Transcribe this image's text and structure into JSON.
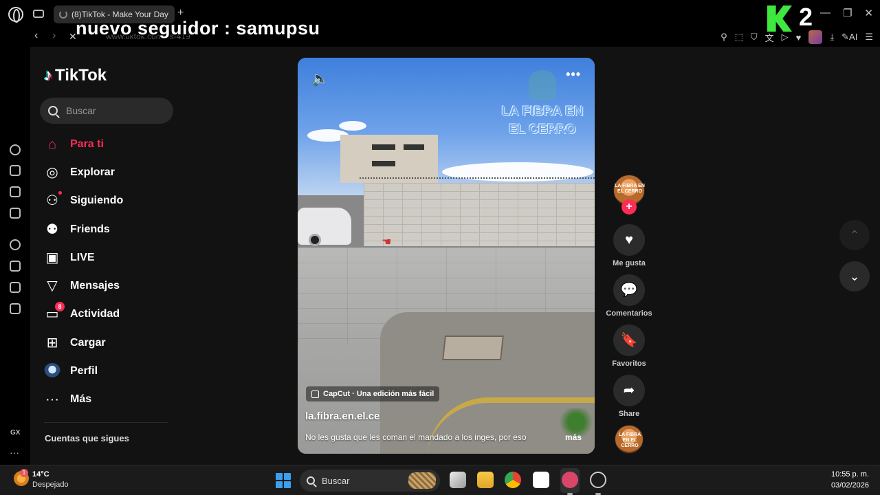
{
  "browser": {
    "tab_title": "(8)TikTok - Make Your Day",
    "new_tab": "+",
    "window_controls": [
      "—",
      "❐",
      "✕"
    ],
    "back": "‹",
    "forward": "›",
    "stop": "✕",
    "url": "www.tiktok.com/es-419",
    "ai_label": "AI",
    "addr_icons": [
      "pin-icon",
      "snapshot-icon",
      "shield-icon",
      "translate-icon",
      "send-icon",
      "heart-icon"
    ]
  },
  "overlay": {
    "text": "nuevo seguidor : samupsu",
    "badge_letter": "K",
    "badge_number": "2"
  },
  "opera_sidebar": {
    "gx_label": "GX",
    "more": "···"
  },
  "tiktok": {
    "logo_text": "TikTok",
    "search_placeholder": "Buscar",
    "nav": [
      {
        "label": "Para ti",
        "icon": "home-icon",
        "active": true
      },
      {
        "label": "Explorar",
        "icon": "compass-icon"
      },
      {
        "label": "Siguiendo",
        "icon": "following-icon"
      },
      {
        "label": "Friends",
        "icon": "friends-icon"
      },
      {
        "label": "LIVE",
        "icon": "live-icon"
      },
      {
        "label": "Mensajes",
        "icon": "messages-icon"
      },
      {
        "label": "Actividad",
        "icon": "activity-icon",
        "badge": "8"
      },
      {
        "label": "Cargar",
        "icon": "upload-icon"
      },
      {
        "label": "Perfil",
        "icon": "avatar"
      },
      {
        "label": "Más",
        "icon": "more-icon"
      }
    ],
    "following_section_title": "Cuentas que sigues"
  },
  "video": {
    "watermark": "LA FIBRA EN EL CERRO",
    "capcut_label": "CapCut · Una edición más fácil",
    "username": "la.fibra.en.el.ce",
    "caption": "No les gusta que les coman el mandado a los inges, por eso",
    "caption_more": "más",
    "more_dots": "•••"
  },
  "actions": {
    "avatar_text": "LA FIBRA EN EL CERRO",
    "follow_plus": "+",
    "like_label": "Me gusta",
    "comments_label": "Comentarios",
    "favorites_label": "Favoritos",
    "share_label": "Share"
  },
  "scroll": {
    "up": "⌃",
    "down": "⌄"
  },
  "taskbar": {
    "weather_temp": "14°C",
    "weather_desc": "Despejado",
    "weather_badge": "1",
    "search_label": "Buscar",
    "time": "10:55 p. m.",
    "date": "03/02/2026"
  },
  "colors": {
    "accent": "#fe2c55",
    "page_bg": "#121212"
  }
}
